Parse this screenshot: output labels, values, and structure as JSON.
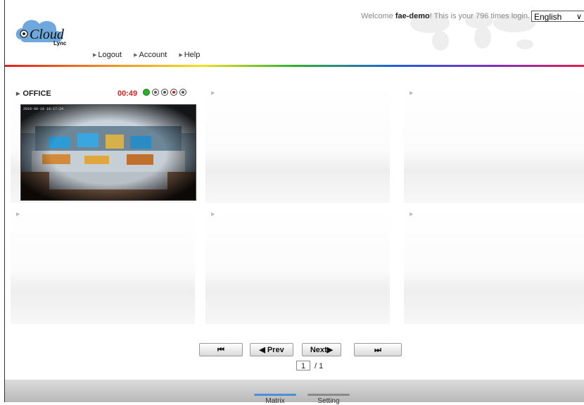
{
  "header": {
    "logo_text": "Cloud",
    "logo_sub": "Lync",
    "welcome_prefix": "Welcome",
    "username": "fae-demo",
    "welcome_suffix": "! This is your 796 times login.",
    "language": "English",
    "nav": [
      {
        "label": "Logout"
      },
      {
        "label": "Account"
      },
      {
        "label": "Help"
      }
    ]
  },
  "cameras": [
    {
      "name": "OFFICE",
      "time": "00:49",
      "stamp": "2018-08-19 18:17:24"
    },
    {
      "name": ""
    },
    {
      "name": ""
    },
    {
      "name": ""
    },
    {
      "name": ""
    },
    {
      "name": ""
    }
  ],
  "pager": {
    "first": "⏮",
    "prev": "◀ Prev",
    "next": "Next▶",
    "last": "⏭",
    "current": "1",
    "total": "/ 1"
  },
  "footer": {
    "tabs": [
      {
        "label": "Matrix"
      },
      {
        "label": "Setting"
      }
    ]
  },
  "colors": {
    "time": "#e02020",
    "active_tab": "#4a90d9"
  }
}
